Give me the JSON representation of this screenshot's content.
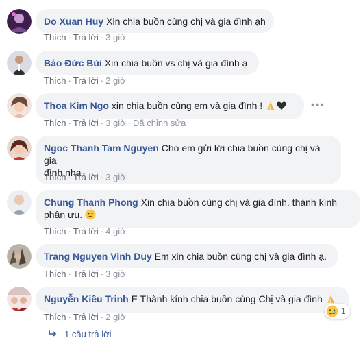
{
  "comments": [
    {
      "author": "Do Xuan Huy",
      "text": "Xin chia buồn cùng chị và gia đình ạh",
      "like": "Thích",
      "reply": "Trả lời",
      "time": "3 giờ"
    },
    {
      "author": "Bảo Đức Bùi",
      "text": "Xin chia buồn vs chị và gia đình ạ",
      "like": "Thích",
      "reply": "Trả lời",
      "time": "2 giờ"
    },
    {
      "author": "Thoa Kim Ngo",
      "text": "xin chia buồn cùng em và gia đình !",
      "like": "Thích",
      "reply": "Trả lời",
      "time": "3 giờ",
      "edited": "Đã chỉnh sửa"
    },
    {
      "author": "Ngoc Thanh Tam Nguyen",
      "text_line1": "Cho em gửi lời chia buồn cùng chị và gia",
      "text_line2": "đình nha",
      "like": "Thích",
      "reply": "Trả lời",
      "time": "3 giờ"
    },
    {
      "author": "Chung Thanh Phong",
      "text_line1": "Xin chia buồn cùng chị và gia đình. thành kính",
      "text_line2": "phân ưu.",
      "like": "Thích",
      "reply": "Trả lời",
      "time": "4 giờ"
    },
    {
      "author": "Trang Nguyen Vinh Duy",
      "text": "Em xin chia buồn cùng chị và gia đình ạ.",
      "like": "Thích",
      "reply": "Trả lời",
      "time": "3 giờ"
    },
    {
      "author": "Nguyễn Kiều Trinh",
      "text": "E Thành kính chia buồn cùng Chị và gia đình",
      "like": "Thích",
      "reply": "Trả lời",
      "time": "2 giờ",
      "reaction_count": "1"
    }
  ],
  "replies_link": "1 câu trả lời",
  "more_options": "•••",
  "separator": "·",
  "colors": {
    "link": "#385898",
    "bubble": "#f2f3f5",
    "meta": "#606770"
  }
}
